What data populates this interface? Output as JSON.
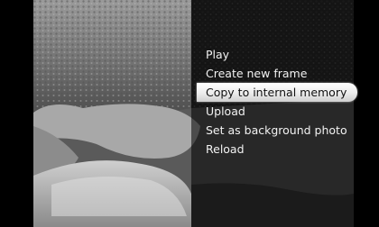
{
  "menu": {
    "items": [
      {
        "label": "Play",
        "selected": false
      },
      {
        "label": "Create new frame",
        "selected": false
      },
      {
        "label": "Copy to internal memory",
        "selected": true
      },
      {
        "label": "Upload",
        "selected": false
      },
      {
        "label": "Set as background photo",
        "selected": false
      },
      {
        "label": "Reload",
        "selected": false
      }
    ]
  },
  "colors": {
    "background": "#000000",
    "menu_text": "#f2f2f2",
    "selected_highlight": "#ffffff",
    "selected_text": "#111111"
  }
}
